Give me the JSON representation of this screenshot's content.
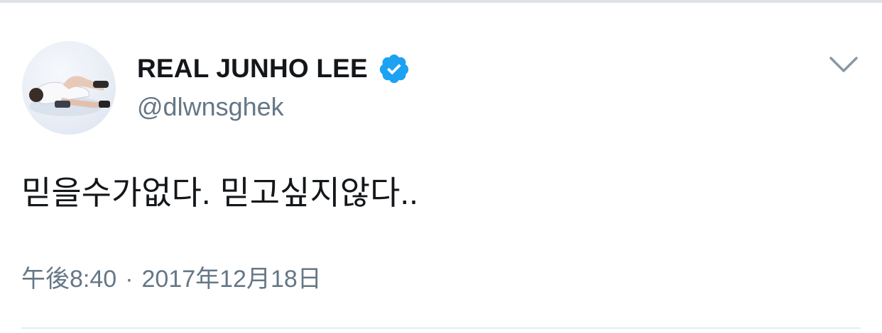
{
  "tweet": {
    "author": {
      "display_name": "REAL JUNHO LEE",
      "handle": "@dlwnsghek",
      "verified": true,
      "verified_color": "#1da1f2",
      "avatar_icon": "profile-photo"
    },
    "text": "믿을수가없다. 믿고싶지않다..",
    "time": "午後8:40",
    "separator": "·",
    "date": "2017年12月18日",
    "menu_icon": "chevron-down-icon"
  },
  "colors": {
    "name": "#14171a",
    "secondary": "#657786",
    "divider": "#e6ecf0",
    "chevron": "#8899a6"
  }
}
